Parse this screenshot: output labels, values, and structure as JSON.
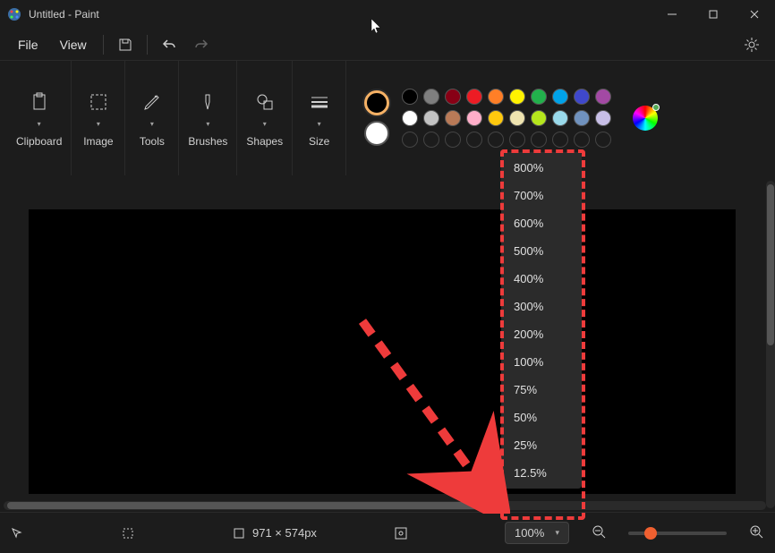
{
  "window": {
    "title": "Untitled - Paint"
  },
  "menu": {
    "file": "File",
    "view": "View"
  },
  "ribbon": {
    "clipboard": "Clipboard",
    "image": "Image",
    "tools": "Tools",
    "brushes": "Brushes",
    "shapes": "Shapes",
    "size": "Size"
  },
  "palette_row1": [
    "#000000",
    "#7f7f7f",
    "#880015",
    "#ed1c24",
    "#ff7f27",
    "#fff200",
    "#22b14c",
    "#00a2e8",
    "#3f48cc",
    "#a349a4"
  ],
  "palette_row2": [
    "#ffffff",
    "#c3c3c3",
    "#b97a57",
    "#ffaec9",
    "#ffc90e",
    "#efe4b0",
    "#b5e61d",
    "#99d9ea",
    "#7092be",
    "#c8bfe7"
  ],
  "status": {
    "dimensions": "971 × 574px",
    "zoom": "100%"
  },
  "zoom_levels": [
    "800%",
    "700%",
    "600%",
    "500%",
    "400%",
    "300%",
    "200%",
    "100%",
    "75%",
    "50%",
    "25%",
    "12.5%"
  ]
}
